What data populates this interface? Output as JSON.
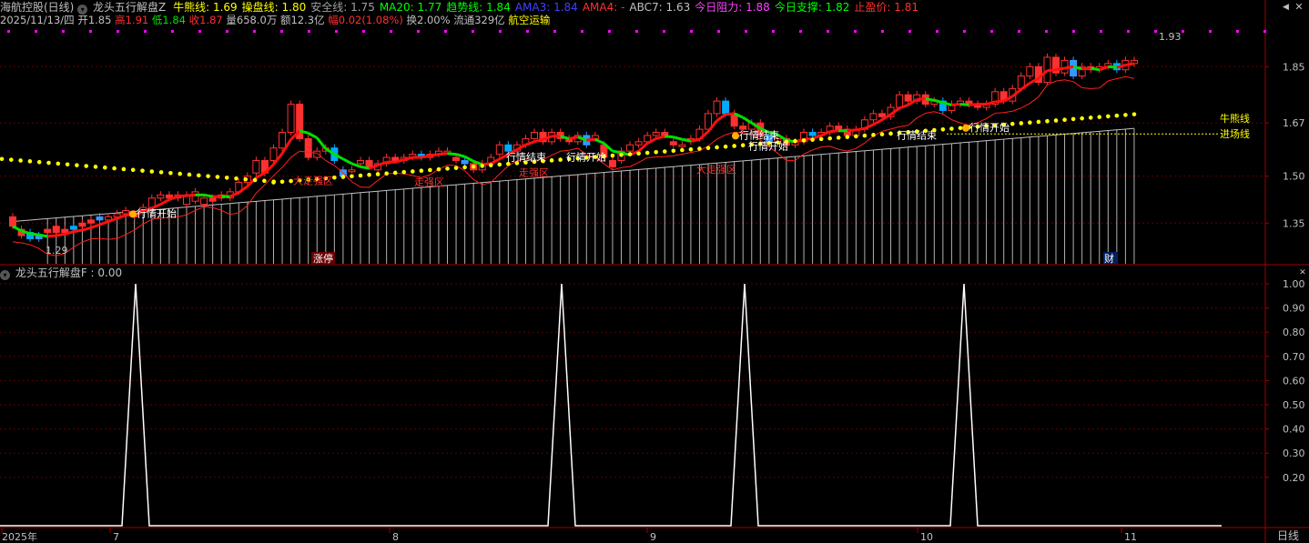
{
  "header": {
    "stock_title": "海航控股(日线)",
    "indicator_name": "龙头五行解盘Z",
    "items": [
      {
        "label": "牛熊线: 1.69",
        "color": "#ffff00"
      },
      {
        "label": "操盘线: 1.80",
        "color": "#ffff00"
      },
      {
        "label": "安全线: 1.75",
        "color": "#a0a0a0"
      },
      {
        "label": "MA20: 1.77",
        "color": "#00ff00"
      },
      {
        "label": "趋势线: 1.84",
        "color": "#00ff00"
      },
      {
        "label": "AMA3: 1.84",
        "color": "#4040ff"
      },
      {
        "label": "AMA4: -",
        "color": "#ff3030"
      },
      {
        "label": "ABC7: 1.63",
        "color": "#c0c0c0"
      },
      {
        "label": "今日阻力: 1.88",
        "color": "#ff40ff"
      },
      {
        "label": "今日支撑: 1.82",
        "color": "#00ff00"
      },
      {
        "label": "止盈价: 1.81",
        "color": "#ff3030"
      }
    ]
  },
  "info": {
    "date": "2025/11/13/四",
    "open": "开1.85",
    "high_label": "高",
    "high": "1.91",
    "low_label": "低",
    "low": "1.84",
    "close_label": "收",
    "close": "1.87",
    "volume": "量658.0万",
    "amount": "额12.3亿",
    "change_label": "幅",
    "change": "0.02(1.08%)",
    "turnover": "换2.00%",
    "float": "流通329亿",
    "sector": "航空运输"
  },
  "sub_indicator": {
    "label": "龙头五行解盘F : 0.00"
  },
  "price_axis": [
    "1.85",
    "1.67",
    "1.50",
    "1.35"
  ],
  "sub_axis": [
    "1.00",
    "0.90",
    "0.80",
    "0.70",
    "0.60",
    "0.50",
    "0.40",
    "0.30",
    "0.20"
  ],
  "time_axis": [
    "2025年",
    "7",
    "8",
    "9",
    "10",
    "11"
  ],
  "timeframe": "日线",
  "markers": {
    "zhangting": "涨停",
    "cai": "财",
    "high_mark": "1.93",
    "low_mark": "1.29",
    "niuxiong": "牛熊线",
    "jinchang": "进场线"
  },
  "annotations": [
    {
      "text": "行情开始",
      "color": "#ffffff"
    },
    {
      "text": "大走强区",
      "color": "#ff3030"
    },
    {
      "text": "走强区",
      "color": "#ff3030"
    },
    {
      "text": "行情结束",
      "color": "#ffffff"
    },
    {
      "text": "走强区",
      "color": "#ff3030"
    },
    {
      "text": "行情开始",
      "color": "#ffffff"
    },
    {
      "text": "行情结束",
      "color": "#ffffff"
    },
    {
      "text": "行情开始",
      "color": "#ffffff"
    },
    {
      "text": "大走强区",
      "color": "#ff3030"
    },
    {
      "text": "行情结束",
      "color": "#ffffff"
    },
    {
      "text": "行情开始",
      "color": "#ffffff"
    }
  ],
  "chart_data": {
    "type": "candlestick",
    "candles": [
      [
        1.37,
        1.34
      ],
      [
        1.33,
        1.31
      ],
      [
        1.32,
        1.3
      ],
      [
        1.31,
        1.3
      ],
      [
        1.33,
        1.32
      ],
      [
        1.34,
        1.32
      ],
      [
        1.33,
        1.32
      ],
      [
        1.34,
        1.33
      ],
      [
        1.35,
        1.34
      ],
      [
        1.36,
        1.35
      ],
      [
        1.37,
        1.36
      ],
      [
        1.36,
        1.37
      ],
      [
        1.37,
        1.38
      ],
      [
        1.38,
        1.39
      ],
      [
        1.38,
        1.37
      ],
      [
        1.39,
        1.4
      ],
      [
        1.4,
        1.43
      ],
      [
        1.43,
        1.44
      ],
      [
        1.44,
        1.43
      ],
      [
        1.43,
        1.44
      ],
      [
        1.41,
        1.44
      ],
      [
        1.42,
        1.45
      ],
      [
        1.41,
        1.43
      ],
      [
        1.43,
        1.42
      ],
      [
        1.43,
        1.44
      ],
      [
        1.43,
        1.45
      ],
      [
        1.45,
        1.48
      ],
      [
        1.48,
        1.5
      ],
      [
        1.51,
        1.55
      ],
      [
        1.55,
        1.51
      ],
      [
        1.55,
        1.59
      ],
      [
        1.59,
        1.64
      ],
      [
        1.64,
        1.73
      ],
      [
        1.73,
        1.62
      ],
      [
        1.62,
        1.56
      ],
      [
        1.56,
        1.58
      ],
      [
        1.58,
        1.59
      ],
      [
        1.59,
        1.55
      ],
      [
        1.52,
        1.5
      ],
      [
        1.52,
        1.52
      ],
      [
        1.54,
        1.55
      ],
      [
        1.55,
        1.53
      ],
      [
        1.52,
        1.54
      ],
      [
        1.54,
        1.56
      ],
      [
        1.56,
        1.55
      ],
      [
        1.55,
        1.56
      ],
      [
        1.56,
        1.57
      ],
      [
        1.57,
        1.56
      ],
      [
        1.56,
        1.57
      ],
      [
        1.57,
        1.58
      ],
      [
        1.58,
        1.58
      ],
      [
        1.56,
        1.55
      ],
      [
        1.55,
        1.54
      ],
      [
        1.54,
        1.52
      ],
      [
        1.52,
        1.54
      ],
      [
        1.54,
        1.56
      ],
      [
        1.57,
        1.6
      ],
      [
        1.6,
        1.58
      ],
      [
        1.58,
        1.6
      ],
      [
        1.6,
        1.62
      ],
      [
        1.62,
        1.64
      ],
      [
        1.64,
        1.61
      ],
      [
        1.61,
        1.64
      ],
      [
        1.64,
        1.62
      ],
      [
        1.62,
        1.61
      ],
      [
        1.61,
        1.63
      ],
      [
        1.63,
        1.6
      ],
      [
        1.62,
        1.63
      ],
      [
        1.6,
        1.56
      ],
      [
        1.55,
        1.53
      ],
      [
        1.55,
        1.58
      ],
      [
        1.58,
        1.6
      ],
      [
        1.6,
        1.61
      ],
      [
        1.61,
        1.63
      ],
      [
        1.63,
        1.64
      ],
      [
        1.64,
        1.63
      ],
      [
        1.61,
        1.6
      ],
      [
        1.6,
        1.6
      ],
      [
        1.61,
        1.62
      ],
      [
        1.62,
        1.65
      ],
      [
        1.65,
        1.7
      ],
      [
        1.7,
        1.74
      ],
      [
        1.74,
        1.7
      ],
      [
        1.7,
        1.66
      ],
      [
        1.66,
        1.65
      ],
      [
        1.65,
        1.67
      ],
      [
        1.67,
        1.63
      ],
      [
        1.63,
        1.61
      ],
      [
        1.61,
        1.62
      ],
      [
        1.62,
        1.6
      ],
      [
        1.6,
        1.61
      ],
      [
        1.61,
        1.64
      ],
      [
        1.64,
        1.63
      ],
      [
        1.63,
        1.64
      ],
      [
        1.64,
        1.66
      ],
      [
        1.66,
        1.65
      ],
      [
        1.65,
        1.63
      ],
      [
        1.63,
        1.65
      ],
      [
        1.65,
        1.68
      ],
      [
        1.68,
        1.7
      ],
      [
        1.7,
        1.69
      ],
      [
        1.69,
        1.72
      ],
      [
        1.72,
        1.76
      ],
      [
        1.76,
        1.74
      ],
      [
        1.74,
        1.76
      ],
      [
        1.76,
        1.73
      ],
      [
        1.73,
        1.74
      ],
      [
        1.74,
        1.71
      ],
      [
        1.71,
        1.73
      ],
      [
        1.73,
        1.74
      ],
      [
        1.74,
        1.73
      ],
      [
        1.73,
        1.72
      ],
      [
        1.72,
        1.73
      ],
      [
        1.73,
        1.77
      ],
      [
        1.77,
        1.74
      ],
      [
        1.74,
        1.78
      ],
      [
        1.78,
        1.82
      ],
      [
        1.82,
        1.85
      ],
      [
        1.85,
        1.8
      ],
      [
        1.8,
        1.88
      ],
      [
        1.88,
        1.83
      ],
      [
        1.83,
        1.87
      ],
      [
        1.87,
        1.82
      ],
      [
        1.82,
        1.85
      ],
      [
        1.85,
        1.84
      ],
      [
        1.84,
        1.85
      ],
      [
        1.85,
        1.86
      ],
      [
        1.86,
        1.84
      ],
      [
        1.84,
        1.87
      ],
      [
        1.86,
        1.87
      ]
    ],
    "price_range": [
      1.22,
      1.97
    ],
    "signal_peaks_index": [
      12,
      60,
      80,
      104
    ],
    "signal_range": [
      0,
      1.0
    ],
    "sub_series_name": "龙头五行解盘F"
  }
}
